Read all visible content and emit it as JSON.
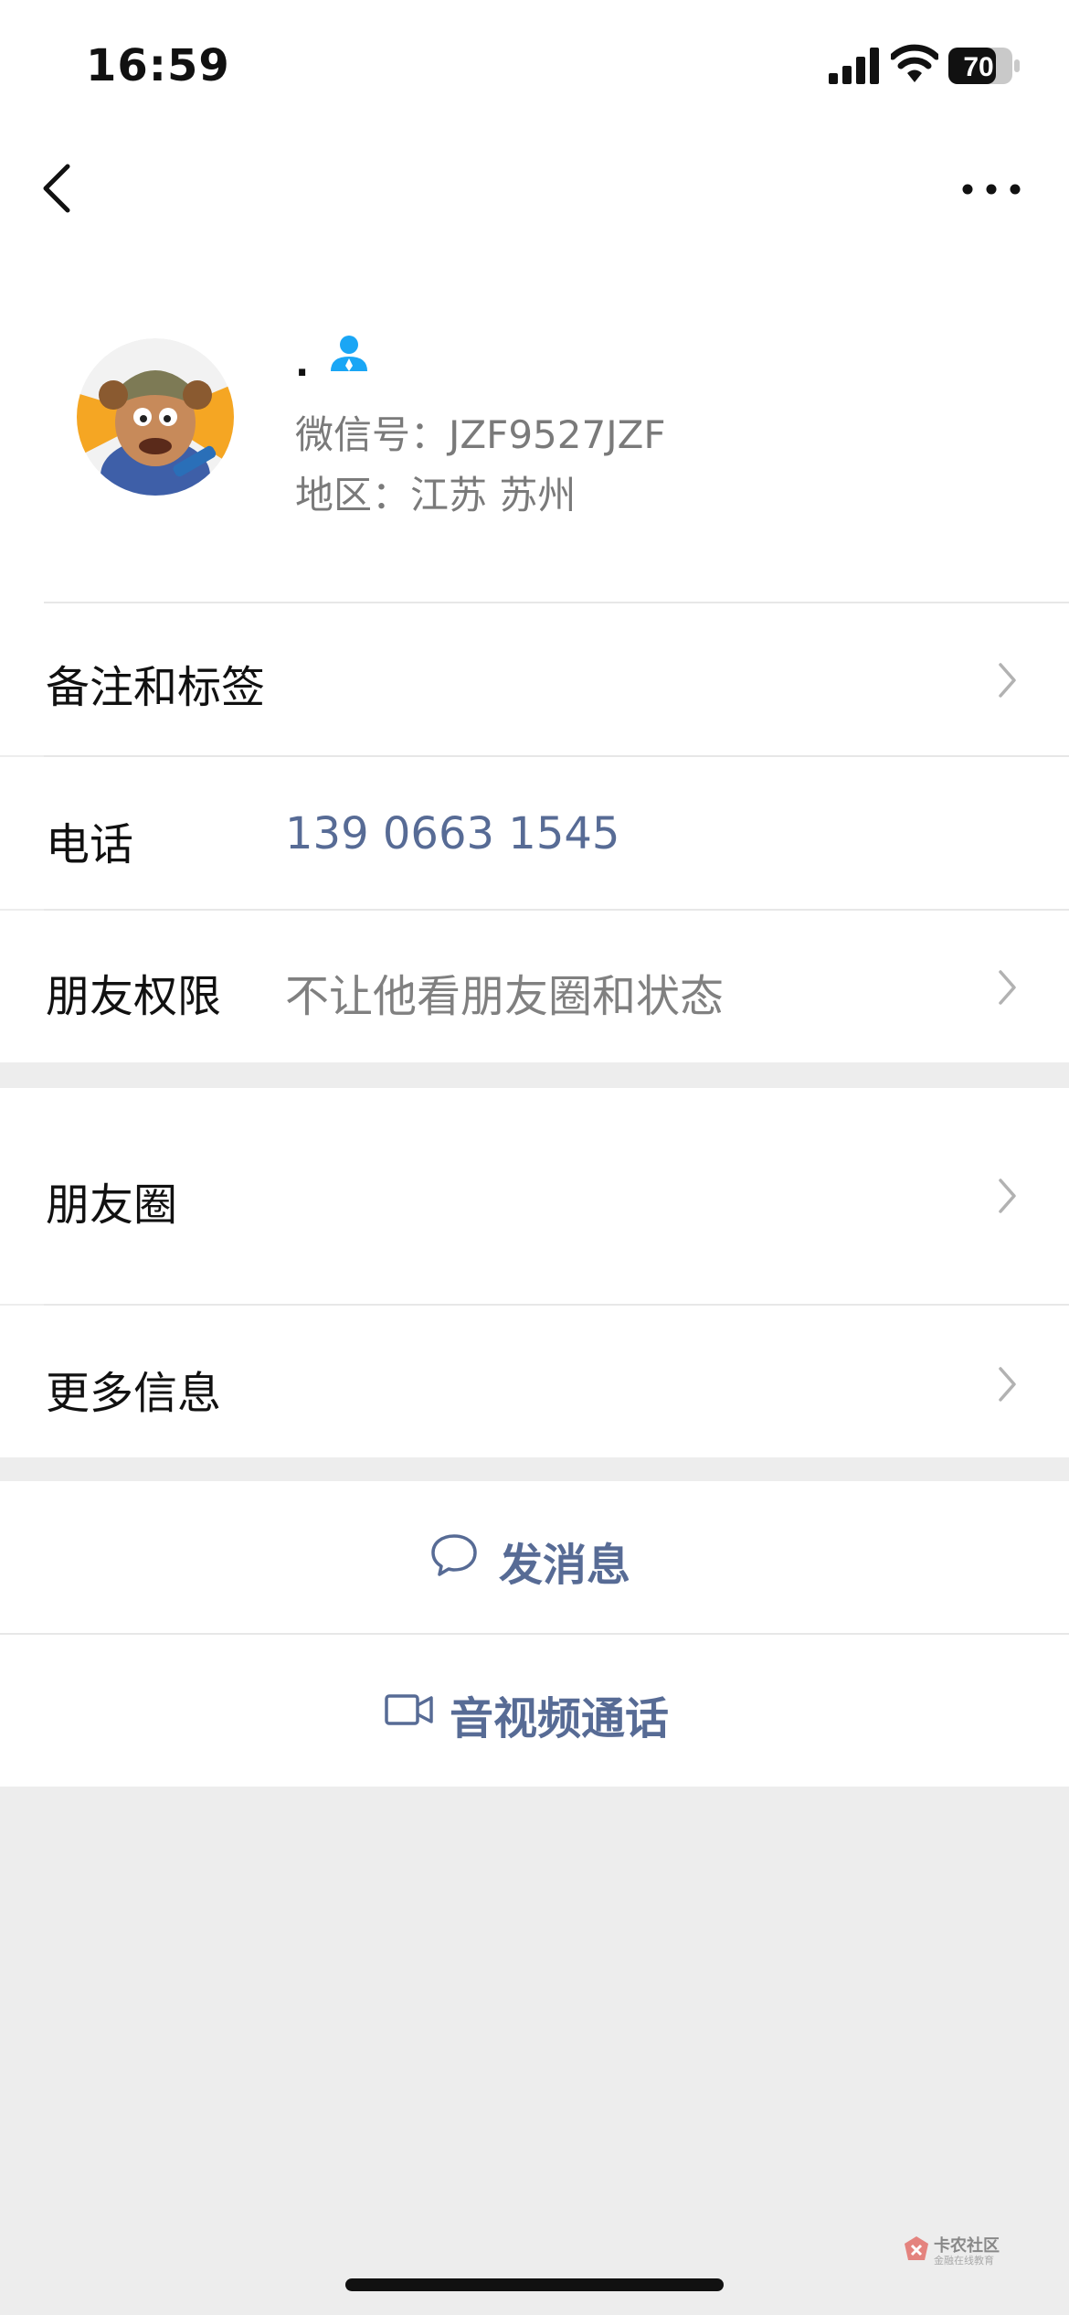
{
  "status_bar": {
    "time": "16:59",
    "battery": "70"
  },
  "profile": {
    "nickname": ".",
    "wechat_id": "微信号：JZF9527JZF",
    "region": "地区：江苏 苏州"
  },
  "rows": {
    "remark": {
      "label": "备注和标签"
    },
    "phone": {
      "label": "电话",
      "value": "139 0663 1545"
    },
    "permissions": {
      "label": "朋友权限",
      "value": "不让他看朋友圈和状态"
    },
    "moments": {
      "label": "朋友圈"
    },
    "more_info": {
      "label": "更多信息"
    }
  },
  "actions": {
    "message": "发消息",
    "call": "音视频通话"
  },
  "watermark": {
    "title": "卡农社区",
    "subtitle": "金融在线教育"
  },
  "colors": {
    "link": "#576b95",
    "accent": "#1aa6f5",
    "background": "#ededed"
  }
}
